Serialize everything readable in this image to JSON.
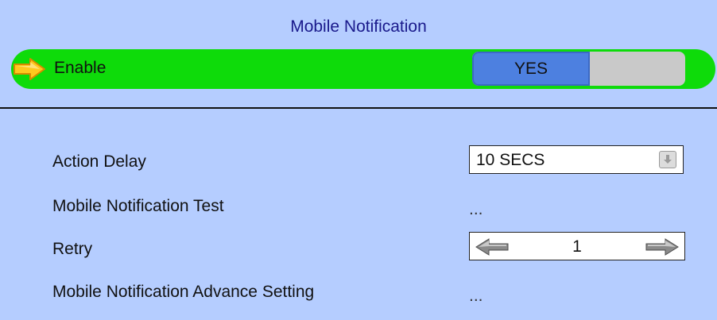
{
  "panel": {
    "title": "Mobile Notification"
  },
  "enable": {
    "label": "Enable",
    "toggle_on_label": "YES",
    "toggle_state": "on",
    "row_color": "#0edb0a",
    "on_color": "#4d80e0",
    "off_color": "#c9c9c9"
  },
  "settings": {
    "action_delay": {
      "label": "Action Delay",
      "value": "10 SECS"
    },
    "test": {
      "label": "Mobile Notification Test",
      "value": "..."
    },
    "retry": {
      "label": "Retry",
      "value": "1"
    },
    "advance": {
      "label": "Mobile Notification Advance Setting",
      "value": "..."
    }
  },
  "icons": {
    "focus_indicator": "arrow-right-icon",
    "dropdown": "dropdown-arrow-icon",
    "decrement": "arrow-left-icon",
    "increment": "arrow-right-icon"
  },
  "colors": {
    "background": "#b5cdff",
    "title": "#1a1a8c"
  }
}
